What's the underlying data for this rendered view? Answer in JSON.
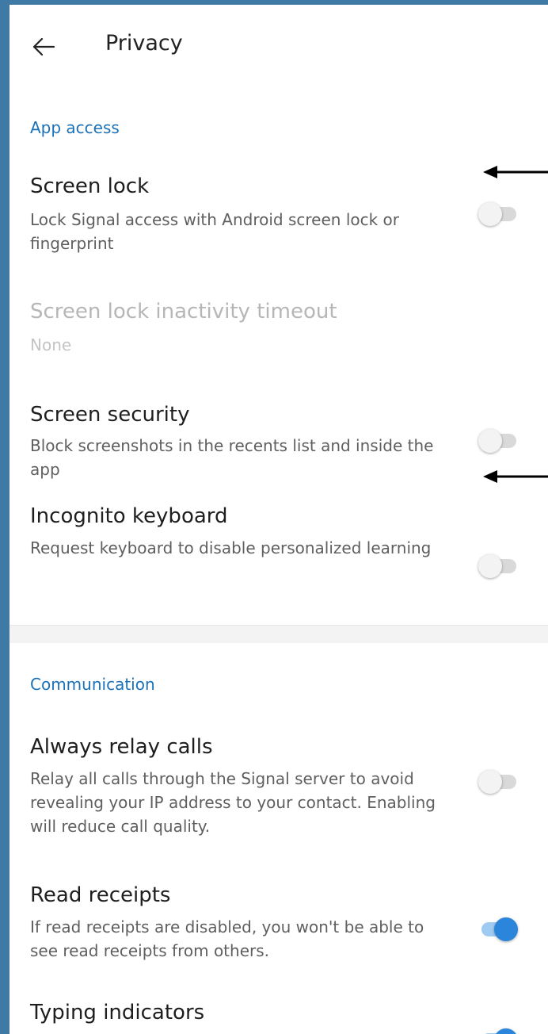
{
  "appbar": {
    "title": "Privacy",
    "back_icon": "arrow-left-icon"
  },
  "sections": {
    "app_access": {
      "header": "App access"
    },
    "communication": {
      "header": "Communication"
    }
  },
  "rows": {
    "screen_lock": {
      "title": "Screen lock",
      "subtitle": "Lock Signal access with Android screen lock or fingerprint",
      "enabled": false
    },
    "inactivity_timeout": {
      "title": "Screen lock inactivity timeout",
      "value": "None"
    },
    "screen_security": {
      "title": "Screen security",
      "subtitle": "Block screenshots in the recents list and inside the app",
      "enabled": false
    },
    "incognito_keyboard": {
      "title": "Incognito keyboard",
      "subtitle": "Request keyboard to disable personalized learning",
      "enabled": false
    },
    "always_relay_calls": {
      "title": "Always relay calls",
      "subtitle": "Relay all calls through the Signal server to avoid revealing your IP address to your contact. Enabling will reduce call quality.",
      "enabled": false
    },
    "read_receipts": {
      "title": "Read receipts",
      "subtitle": "If read receipts are disabled, you won't be able to see read receipts from others.",
      "enabled": true
    },
    "typing_indicators": {
      "title": "Typing indicators",
      "enabled": true
    }
  },
  "colors": {
    "accent": "#2b86db",
    "section_header": "#1b72b8",
    "outer_border": "#3f79a6"
  },
  "annotations": {
    "arrow_icon": "annotation-arrow-left-icon"
  }
}
